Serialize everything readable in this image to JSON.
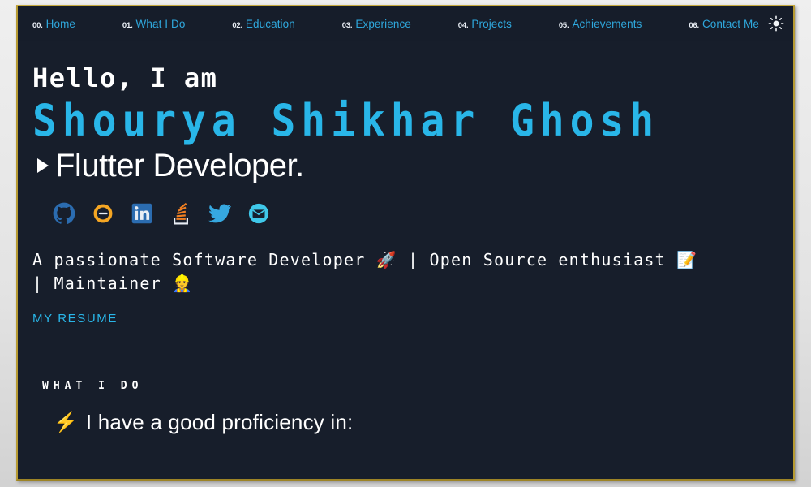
{
  "theme": {
    "background": "#171e2b",
    "accent": "#29b6e8",
    "nav_number_color": "#e9eef5",
    "border_color": "#b79b33",
    "text_color": "#ffffff"
  },
  "nav": {
    "items": [
      {
        "num": "00.",
        "label": "Home"
      },
      {
        "num": "01.",
        "label": "What I Do"
      },
      {
        "num": "02.",
        "label": "Education"
      },
      {
        "num": "03.",
        "label": "Experience"
      },
      {
        "num": "04.",
        "label": "Projects"
      },
      {
        "num": "05.",
        "label": "Achievements"
      },
      {
        "num": "06.",
        "label": "Contact Me"
      }
    ],
    "theme_toggle_icon": "sun-icon"
  },
  "hero": {
    "greeting": "Hello, I am",
    "name": "Shourya Shikhar Ghosh",
    "role": "Flutter Developer.",
    "role_bullet_icon": "play-triangle-icon",
    "description": "A passionate Software Developer 🚀 | Open Source enthusiast 📝 | Maintainer 👷",
    "resume_label": "MY RESUME",
    "socials": [
      {
        "name": "github-icon",
        "label": "GitHub"
      },
      {
        "name": "hashnode-icon",
        "label": "Hashnode"
      },
      {
        "name": "linkedin-icon",
        "label": "LinkedIn"
      },
      {
        "name": "stackoverflow-icon",
        "label": "Stack Overflow"
      },
      {
        "name": "twitter-icon",
        "label": "Twitter"
      },
      {
        "name": "email-icon",
        "label": "Email"
      }
    ]
  },
  "what_i_do": {
    "kicker": "WHAT I DO",
    "proficiency_icon": "⚡",
    "proficiency_text": "I have a good proficiency in:"
  }
}
